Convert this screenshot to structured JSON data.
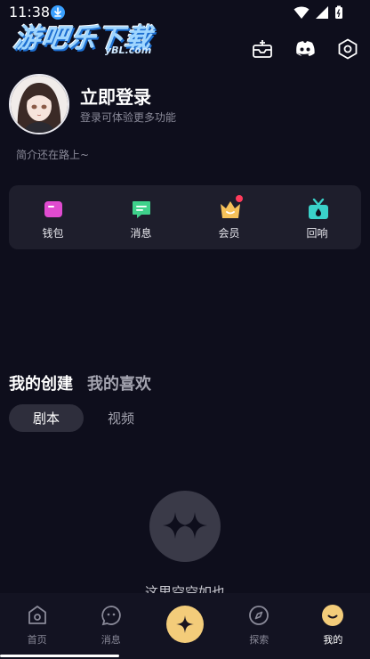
{
  "status_bar": {
    "time": "11:38"
  },
  "watermark": {
    "title": "游吧乐下载",
    "subtitle": "yBL.com"
  },
  "profile": {
    "login_title": "立即登录",
    "login_subtitle": "登录可体验更多功能",
    "bio": "简介还在路上~"
  },
  "quick_menu": [
    {
      "label": "钱包",
      "icon": "wallet-icon",
      "color": "#e04bd0"
    },
    {
      "label": "消息",
      "icon": "message-icon",
      "color": "#3fd18b"
    },
    {
      "label": "会员",
      "icon": "crown-icon",
      "color": "#f6c25a",
      "badge": true
    },
    {
      "label": "回响",
      "icon": "gift-box-icon",
      "color": "#3ad1c9"
    }
  ],
  "content_tabs": {
    "created": "我的创建",
    "liked": "我的喜欢"
  },
  "sub_tabs": {
    "script": "剧本",
    "video": "视频"
  },
  "empty_state": {
    "text": "这里空空如也"
  },
  "bottom_nav": {
    "home": "首页",
    "messages": "消息",
    "explore": "探索",
    "mine": "我的"
  },
  "colors": {
    "background": "#0e0e1c",
    "card": "#1e1e2c",
    "accent": "#f3cc7a"
  }
}
